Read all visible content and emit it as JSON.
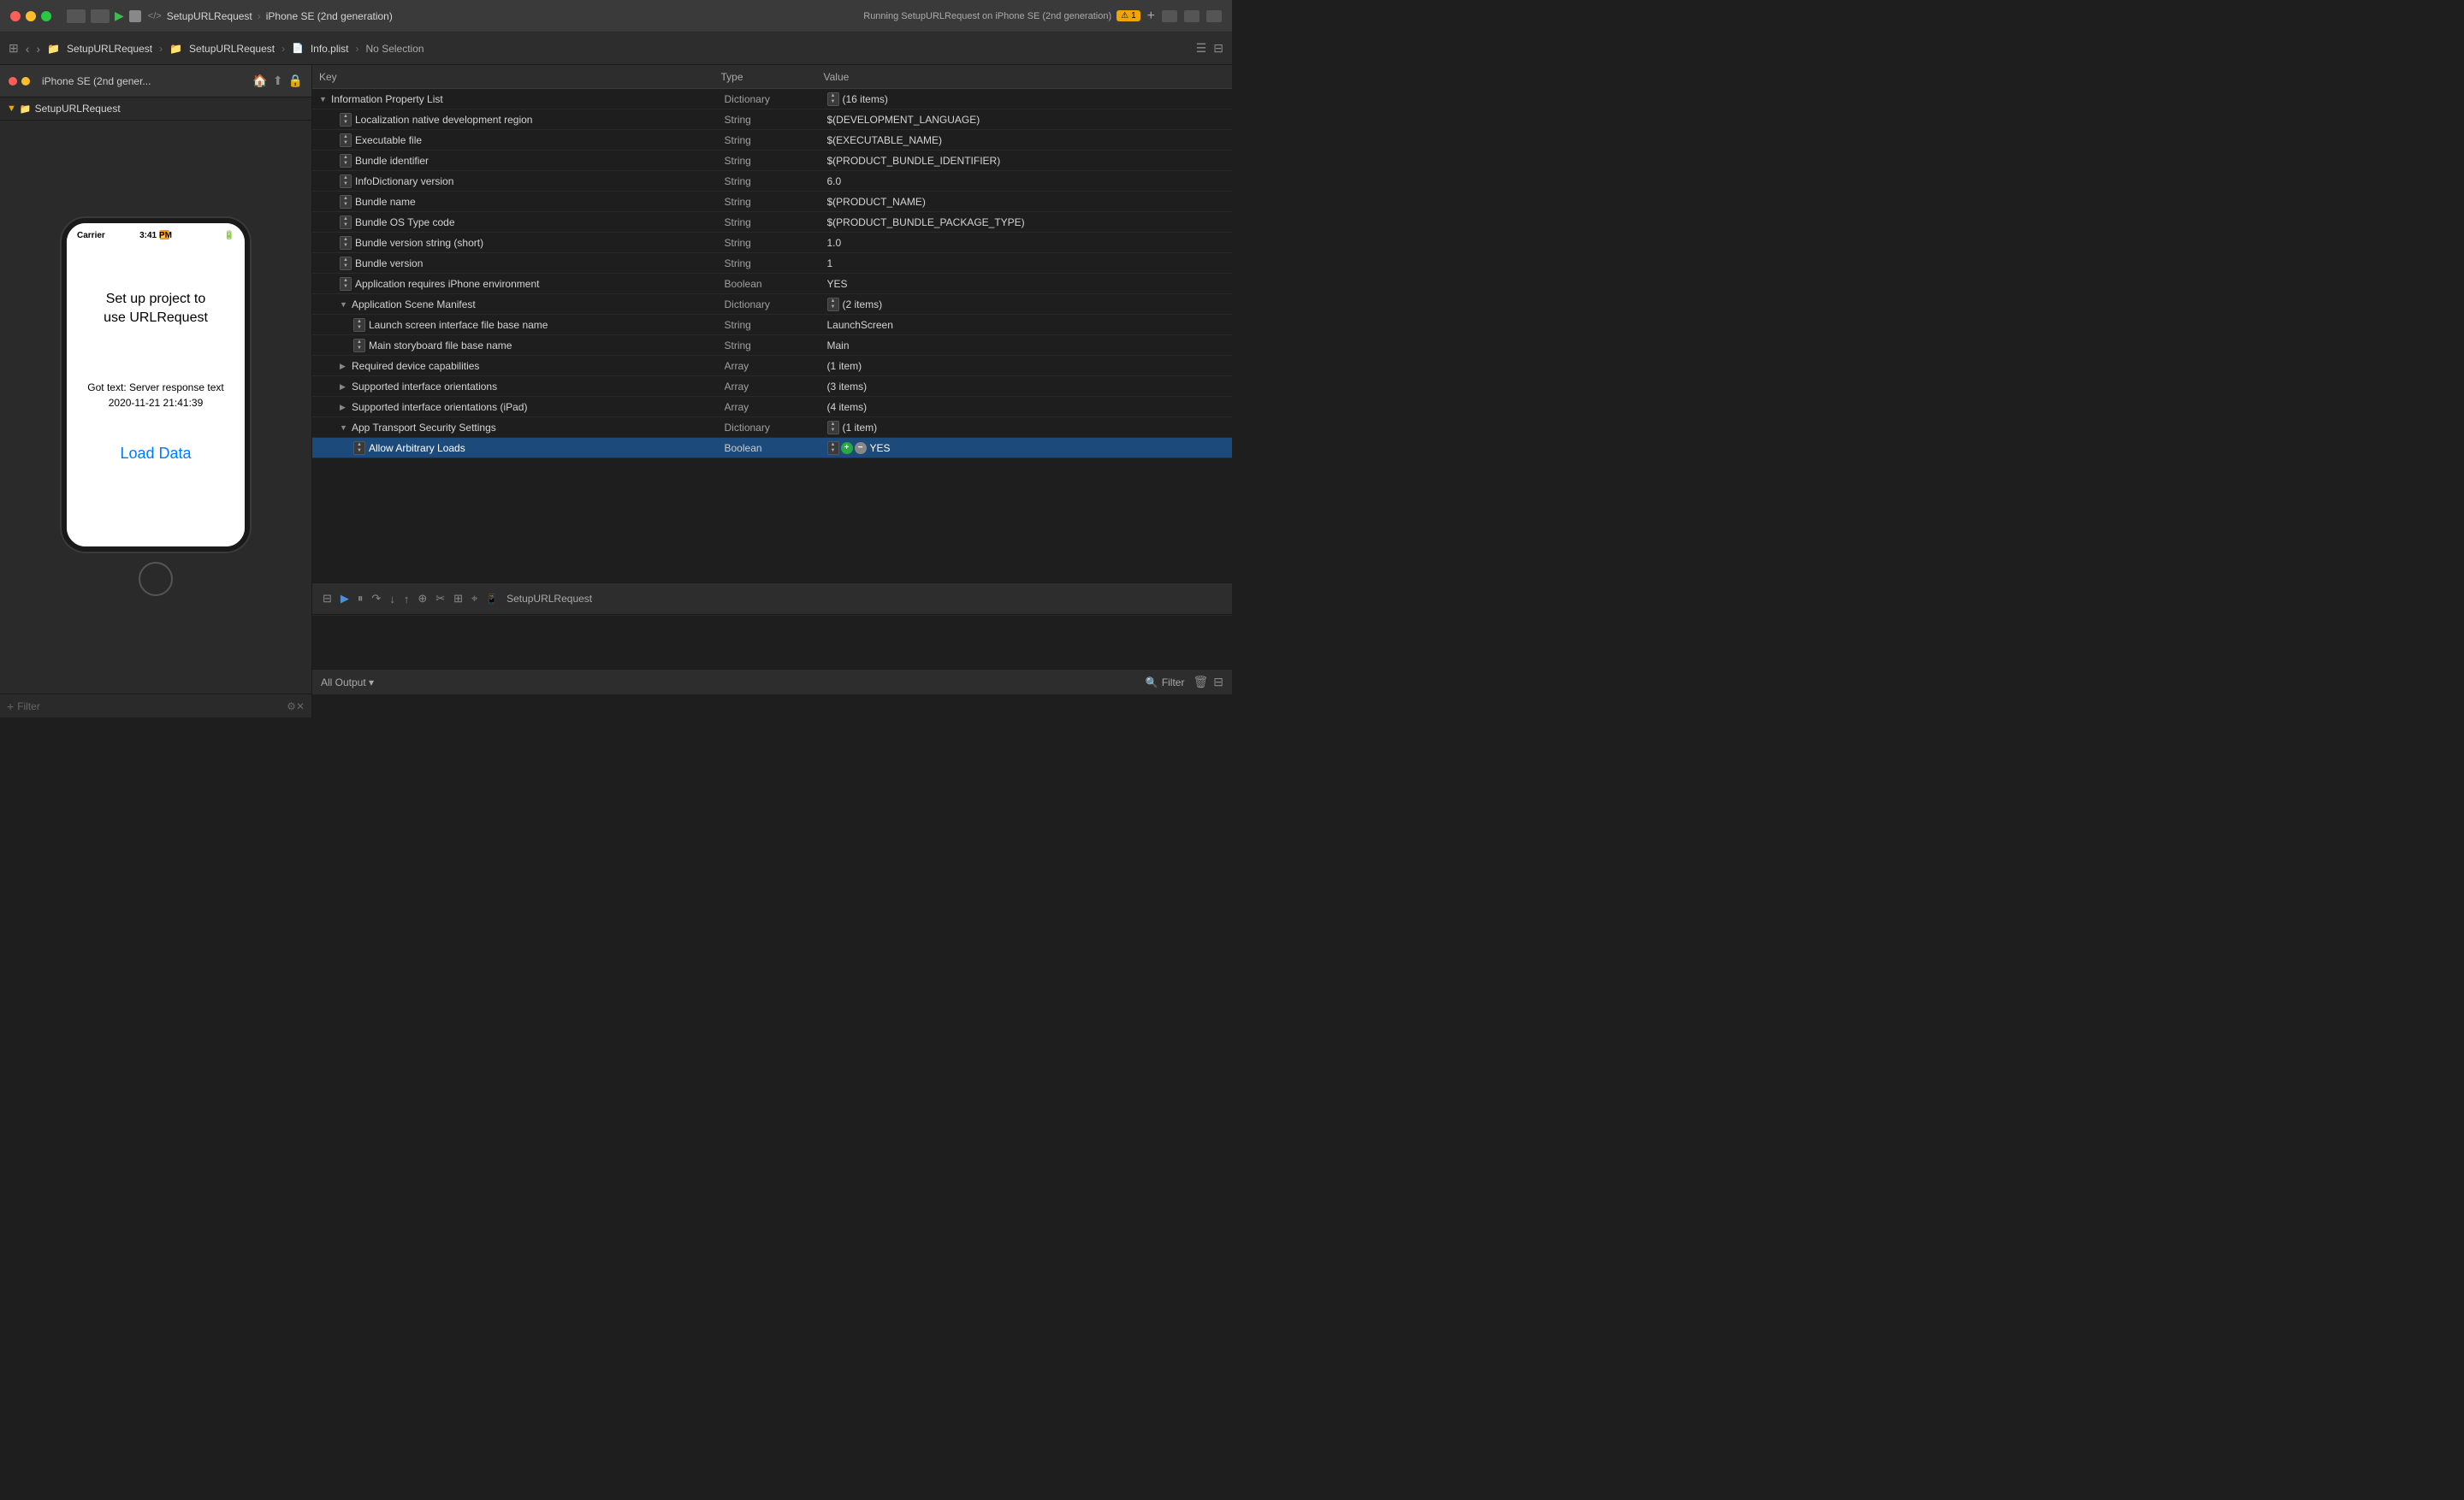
{
  "titleBar": {
    "trafficLights": [
      "red",
      "yellow",
      "green"
    ],
    "scheme": "SetupURLRequest",
    "separator1": "›",
    "device": "iPhone SE (2nd generation)",
    "runningLabel": "Running SetupURLRequest on iPhone SE (2nd generation)",
    "warningCount": "1",
    "plusLabel": "+"
  },
  "toolbar": {
    "navItems": [
      "←",
      "→"
    ]
  },
  "leftPanel": {
    "header": {
      "appName": "iPhone SE (2nd gener...",
      "icons": [
        "home",
        "share",
        "lock"
      ]
    },
    "tree": {
      "rootItem": "SetupURLRequest"
    },
    "simulator": {
      "statusBar": {
        "carrier": "Carrier",
        "wifi": "▶",
        "time": "3:41 PM",
        "battery": "▮▮▮"
      },
      "titleLine1": "Set up project to",
      "titleLine2": "use URLRequest",
      "responseText": "Got text: Server response text",
      "dateText": "2020-11-21 21:41:39",
      "loadButton": "Load Data"
    },
    "filterLabel": "Filter"
  },
  "breadcrumb": {
    "items": [
      "SetupURLRequest",
      "SetupURLRequest",
      "Info.plist",
      "No Selection"
    ],
    "icons": [
      "folder",
      "folder",
      "plist"
    ]
  },
  "plistTable": {
    "headers": [
      "Key",
      "Type",
      "Value"
    ],
    "rows": [
      {
        "indent": 0,
        "expanded": true,
        "key": "Information Property List",
        "type": "Dictionary",
        "value": "(16 items)"
      },
      {
        "indent": 1,
        "key": "Localization native development region",
        "type": "String",
        "value": "$(DEVELOPMENT_LANGUAGE)"
      },
      {
        "indent": 1,
        "key": "Executable file",
        "type": "String",
        "value": "$(EXECUTABLE_NAME)"
      },
      {
        "indent": 1,
        "key": "Bundle identifier",
        "type": "String",
        "value": "$(PRODUCT_BUNDLE_IDENTIFIER)"
      },
      {
        "indent": 1,
        "key": "InfoDictionary version",
        "type": "String",
        "value": "6.0"
      },
      {
        "indent": 1,
        "key": "Bundle name",
        "type": "String",
        "value": "$(PRODUCT_NAME)"
      },
      {
        "indent": 1,
        "key": "Bundle OS Type code",
        "type": "String",
        "value": "$(PRODUCT_BUNDLE_PACKAGE_TYPE)"
      },
      {
        "indent": 1,
        "key": "Bundle version string (short)",
        "type": "String",
        "value": "1.0"
      },
      {
        "indent": 1,
        "key": "Bundle version",
        "type": "String",
        "value": "1"
      },
      {
        "indent": 1,
        "key": "Application requires iPhone environment",
        "type": "Boolean",
        "value": "YES"
      },
      {
        "indent": 1,
        "expanded": true,
        "key": "Application Scene Manifest",
        "type": "Dictionary",
        "value": "(2 items)"
      },
      {
        "indent": 2,
        "key": "Launch screen interface file base name",
        "type": "String",
        "value": "LaunchScreen"
      },
      {
        "indent": 2,
        "key": "Main storyboard file base name",
        "type": "String",
        "value": "Main"
      },
      {
        "indent": 1,
        "collapsed": true,
        "key": "Required device capabilities",
        "type": "Array",
        "value": "(1 item)"
      },
      {
        "indent": 1,
        "collapsed": true,
        "key": "Supported interface orientations",
        "type": "Array",
        "value": "(3 items)"
      },
      {
        "indent": 1,
        "collapsed": true,
        "key": "Supported interface orientations (iPad)",
        "type": "Array",
        "value": "(4 items)"
      },
      {
        "indent": 1,
        "expanded": true,
        "key": "App Transport Security Settings",
        "type": "Dictionary",
        "value": "(1 item)"
      },
      {
        "indent": 2,
        "key": "Allow Arbitrary Loads",
        "type": "Boolean",
        "value": "YES",
        "selected": true,
        "hasRowControls": true
      }
    ]
  },
  "debugBar": {
    "icons": [
      "filter",
      "play",
      "pause",
      "stepOver",
      "stepIn",
      "stepOut",
      "split",
      "thread",
      "locate",
      "arrow"
    ],
    "appLabel": "SetupURLRequest"
  },
  "outputArea": {
    "header": "All Output ▾",
    "filterLabel": "Filter"
  }
}
